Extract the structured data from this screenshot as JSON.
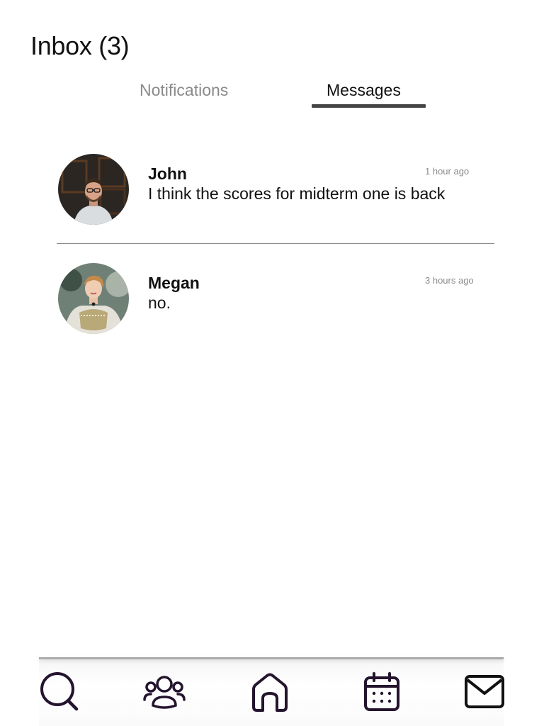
{
  "header": {
    "title": "Inbox (3)"
  },
  "tabs": [
    {
      "label": "Notifications",
      "active": false
    },
    {
      "label": "Messages",
      "active": true
    }
  ],
  "messages": [
    {
      "sender": "John",
      "preview": "I think the scores for midterm one is back",
      "time": "1 hour ago"
    },
    {
      "sender": "Megan",
      "preview": "no.",
      "time": "3 hours ago"
    }
  ],
  "bottom_nav": {
    "items": [
      {
        "icon": "search-icon"
      },
      {
        "icon": "people-icon"
      },
      {
        "icon": "home-icon"
      },
      {
        "icon": "calendar-icon"
      },
      {
        "icon": "mail-icon"
      }
    ]
  },
  "colors": {
    "icon_stroke": "#24142e",
    "active_tab_underline": "#444444",
    "inactive_tab": "#8a8a8a"
  }
}
